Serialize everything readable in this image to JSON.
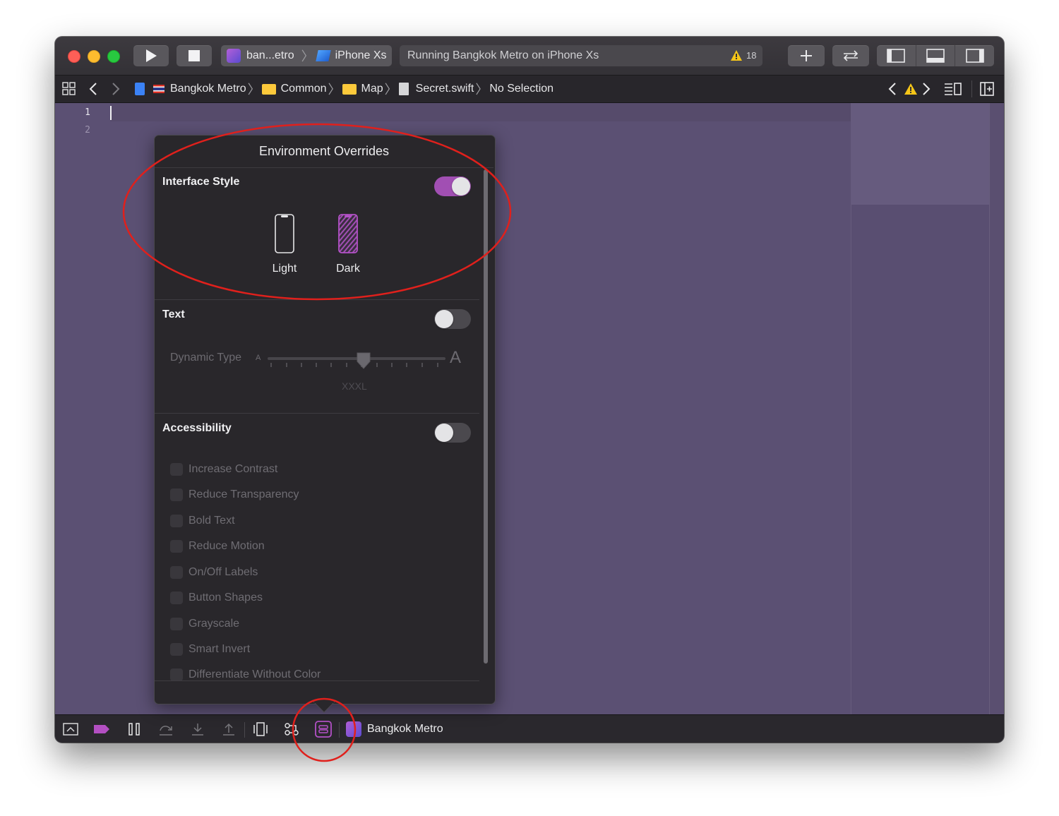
{
  "toolbar": {
    "scheme": {
      "app": "ban...etro",
      "device": "iPhone Xs"
    },
    "status": {
      "text": "Running Bangkok Metro on iPhone Xs",
      "warning_count": "18"
    },
    "icons": [
      "play-icon",
      "stop-icon",
      "add-icon",
      "back-forward-icon",
      "navigator-icon",
      "debug-area-icon",
      "inspector-icon"
    ]
  },
  "jumpbar": {
    "crumbs": [
      "Bangkok Metro",
      "Common",
      "Map",
      "Secret.swift",
      "No Selection"
    ]
  },
  "editor": {
    "line_numbers": [
      "1",
      "2"
    ]
  },
  "popover": {
    "title": "Environment Overrides",
    "interface_style": {
      "label": "Interface Style",
      "enabled": true,
      "options": [
        "Light",
        "Dark"
      ],
      "selected": "Dark"
    },
    "text": {
      "label": "Text",
      "enabled": false,
      "dynamic_type_label": "Dynamic Type",
      "small_a": "A",
      "large_a": "A",
      "size_value": "XXXL"
    },
    "accessibility": {
      "label": "Accessibility",
      "enabled": false,
      "options": [
        "Increase Contrast",
        "Reduce Transparency",
        "Bold Text",
        "Reduce Motion",
        "On/Off Labels",
        "Button Shapes",
        "Grayscale",
        "Smart Invert",
        "Differentiate Without Color"
      ]
    }
  },
  "debugbar": {
    "target": "Bangkok Metro"
  },
  "colors": {
    "editor_bg": "#5b5073",
    "accent": "#a14fb3",
    "annotation": "#e0201c"
  }
}
